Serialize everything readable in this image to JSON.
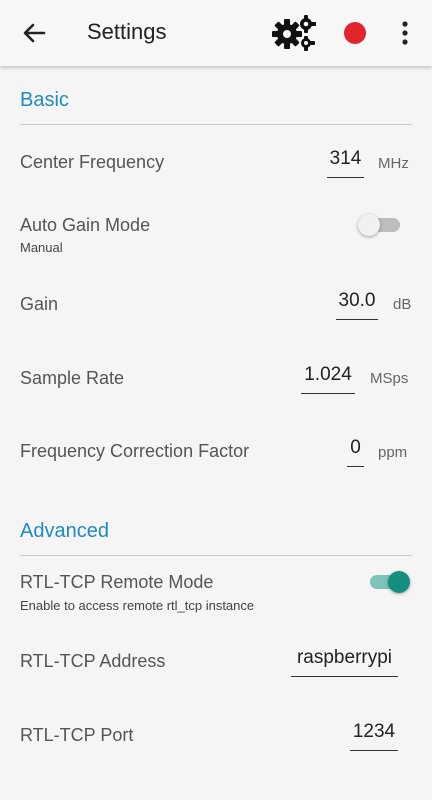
{
  "colors": {
    "accent": "#1e8cc0",
    "toggle_on_thumb": "#158e7f",
    "toggle_on_track": "#7cc4b9",
    "record": "#e0262b"
  },
  "appbar": {
    "title": "Settings",
    "back_icon": "arrow-left",
    "settings_icon": "gears",
    "record_icon": "red-circle",
    "more_icon": "vertical-dots"
  },
  "basic": {
    "title": "Basic",
    "center_frequency": {
      "label": "Center Frequency",
      "value": "314",
      "unit": "MHz"
    },
    "auto_gain": {
      "label": "Auto Gain Mode",
      "summary": "Manual",
      "enabled": false
    },
    "gain": {
      "label": "Gain",
      "value": "30.0",
      "unit": "dB"
    },
    "sample_rate": {
      "label": "Sample Rate",
      "value": "1.024",
      "unit": "MSps"
    },
    "freq_correction": {
      "label": "Frequency Correction Factor",
      "value": "0",
      "unit": "ppm"
    }
  },
  "advanced": {
    "title": "Advanced",
    "remote_mode": {
      "label": "RTL-TCP Remote Mode",
      "summary": "Enable to access remote rtl_tcp instance",
      "enabled": true
    },
    "address": {
      "label": "RTL-TCP Address",
      "value": "raspberrypi"
    },
    "port": {
      "label": "RTL-TCP Port",
      "value": "1234"
    }
  }
}
